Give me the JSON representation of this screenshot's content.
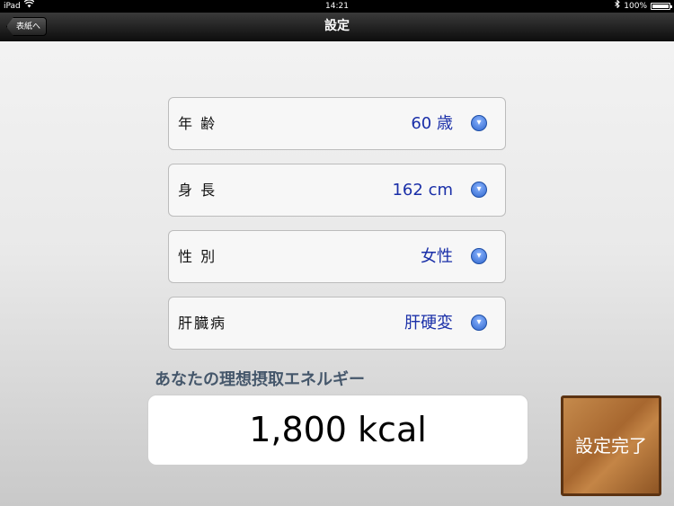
{
  "status_bar": {
    "device": "iPad",
    "time": "14:21",
    "battery": "100%"
  },
  "nav": {
    "back_label": "表紙へ",
    "title": "設定"
  },
  "settings": [
    {
      "label": "年 齢",
      "value": "60 歳"
    },
    {
      "label": "身 長",
      "value": "162 cm"
    },
    {
      "label": "性 別",
      "value": "女性"
    },
    {
      "label": "肝臓病",
      "value": "肝硬変"
    }
  ],
  "energy": {
    "caption": "あなたの理想摂取エネルギー",
    "value": "1,800 kcal"
  },
  "done_button_label": "設定完了",
  "icons": {
    "chevron": "chevron-down-icon",
    "wifi": "wifi-icon",
    "bluetooth": "bluetooth-icon",
    "battery": "battery-icon"
  },
  "colors": {
    "value_text": "#1a2fa8",
    "caption_text": "#45576b"
  }
}
